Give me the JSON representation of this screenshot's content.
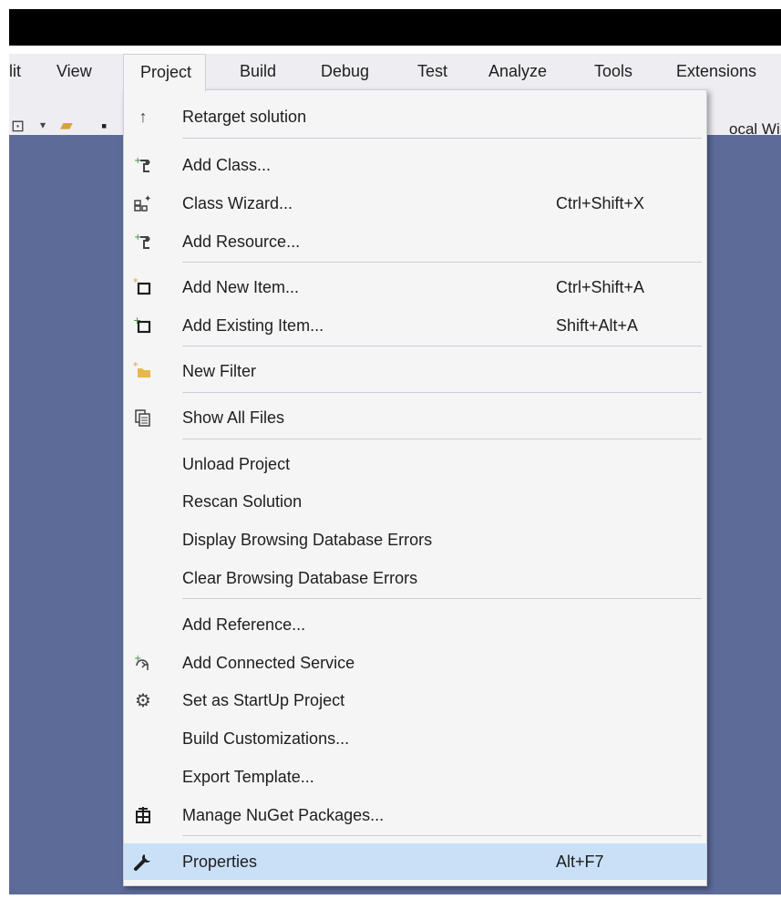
{
  "menubar": {
    "items": [
      {
        "label": "lit"
      },
      {
        "label": "View"
      },
      {
        "label": "Project"
      },
      {
        "label": "Build"
      },
      {
        "label": "Debug"
      },
      {
        "label": "Test"
      },
      {
        "label": "Analyze"
      },
      {
        "label": "Tools"
      },
      {
        "label": "Extensions"
      }
    ]
  },
  "toolbar": {
    "target_text": "ocal Win"
  },
  "project_menu": {
    "items": [
      {
        "label": "Retarget solution",
        "shortcut": "",
        "icon": "up-arrow-icon"
      },
      {
        "label": "Add Class...",
        "shortcut": "",
        "icon": "add-class-icon"
      },
      {
        "label": "Class Wizard...",
        "shortcut": "Ctrl+Shift+X",
        "icon": "class-wizard-icon"
      },
      {
        "label": "Add Resource...",
        "shortcut": "",
        "icon": "add-resource-icon"
      },
      {
        "label": "Add New Item...",
        "shortcut": "Ctrl+Shift+A",
        "icon": "new-item-icon"
      },
      {
        "label": "Add Existing Item...",
        "shortcut": "Shift+Alt+A",
        "icon": "existing-item-icon"
      },
      {
        "label": "New Filter",
        "shortcut": "",
        "icon": "new-filter-icon"
      },
      {
        "label": "Show All Files",
        "shortcut": "",
        "icon": "show-all-files-icon"
      },
      {
        "label": "Unload Project",
        "shortcut": "",
        "icon": ""
      },
      {
        "label": "Rescan Solution",
        "shortcut": "",
        "icon": ""
      },
      {
        "label": "Display Browsing Database Errors",
        "shortcut": "",
        "icon": ""
      },
      {
        "label": "Clear Browsing Database Errors",
        "shortcut": "",
        "icon": ""
      },
      {
        "label": "Add Reference...",
        "shortcut": "",
        "icon": ""
      },
      {
        "label": "Add Connected Service",
        "shortcut": "",
        "icon": "connected-service-icon"
      },
      {
        "label": "Set as StartUp Project",
        "shortcut": "",
        "icon": "gear-icon"
      },
      {
        "label": "Build Customizations...",
        "shortcut": "",
        "icon": ""
      },
      {
        "label": "Export Template...",
        "shortcut": "",
        "icon": ""
      },
      {
        "label": "Manage NuGet Packages...",
        "shortcut": "",
        "icon": "nuget-icon"
      },
      {
        "label": "Properties",
        "shortcut": "Alt+F7",
        "icon": "wrench-icon"
      }
    ]
  },
  "colors": {
    "workspace": "#5d6b99",
    "menu_bg": "#f5f5f5",
    "highlight": "#c9e0f7",
    "titlebar": "#000000"
  }
}
